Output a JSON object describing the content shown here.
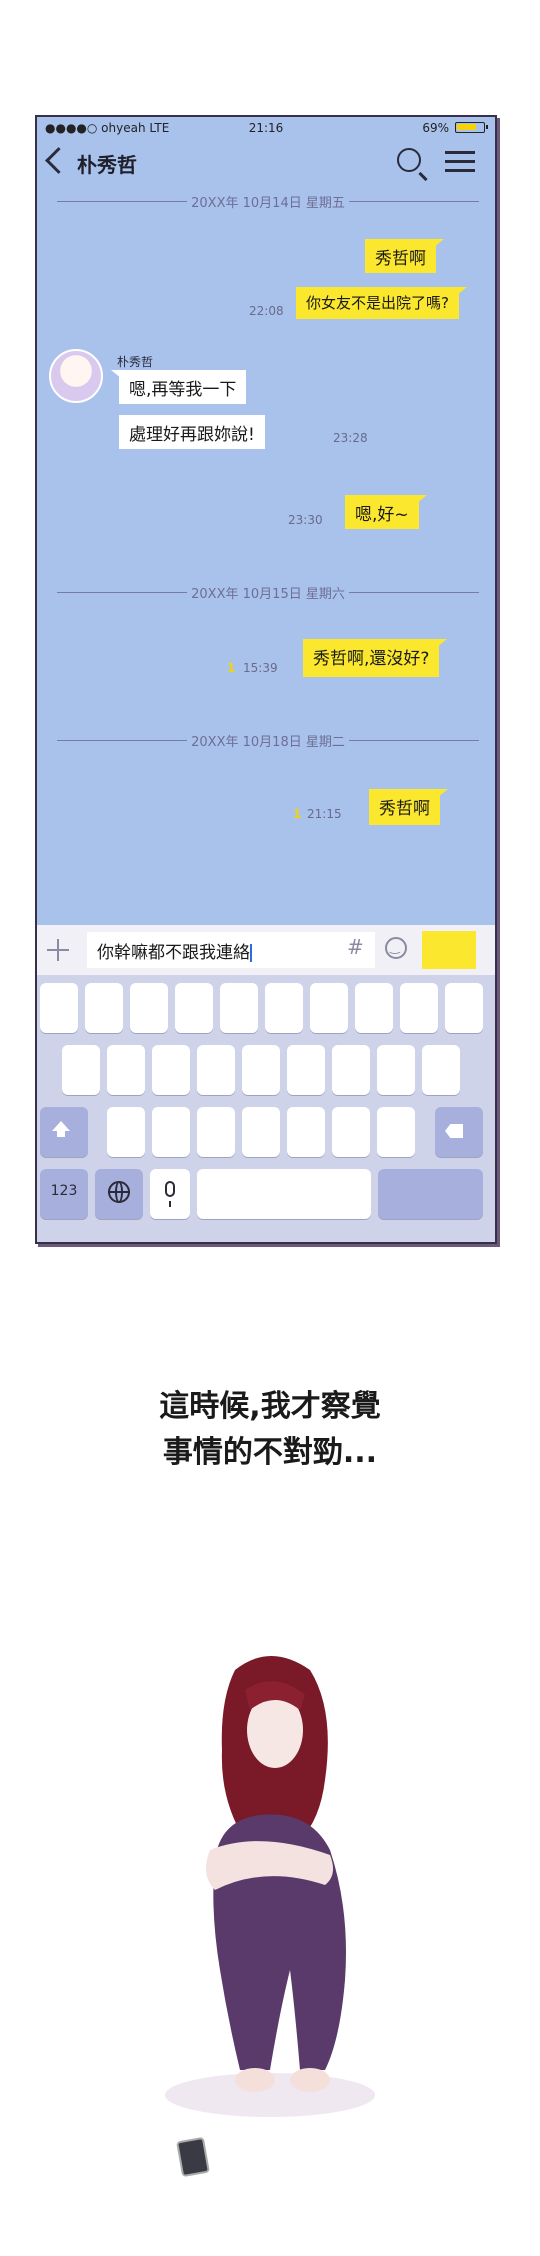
{
  "status_bar": {
    "carrier": "●●●●○ ohyeah  LTE",
    "time": "21:16",
    "battery": "69%"
  },
  "header": {
    "title": "朴秀哲"
  },
  "chat": {
    "date1": "20XX年 10月14日 星期五",
    "date2": "20XX年 10月15日 星期六",
    "date3": "20XX年 10月18日 星期二",
    "msg1": "秀哲啊",
    "msg2": "你女友不是出院了嗎?",
    "msg2_time": "22:08",
    "sender_name": "朴秀哲",
    "msg3": "嗯,再等我一下",
    "msg4": "處理好再跟妳說!",
    "msg4_time": "23:28",
    "msg5": "嗯,好~",
    "msg5_time": "23:30",
    "msg6": "秀哲啊,還沒好?",
    "msg6_time": "15:39",
    "msg6_read": "1",
    "msg7": "秀哲啊",
    "msg7_time": "21:15",
    "msg7_read": "1"
  },
  "input": {
    "text": "你幹嘛都不跟我連絡",
    "hash": "#"
  },
  "keyboard": {
    "num_label": "123"
  },
  "caption": {
    "line1": "這時候,我才察覺",
    "line2": "事情的不對勁..."
  },
  "colors": {
    "chat_bg": "#a8c2ec",
    "outgoing_bubble": "#fbe72d",
    "incoming_bubble": "#ffffff",
    "keyboard_bg": "#cfd3ea"
  }
}
